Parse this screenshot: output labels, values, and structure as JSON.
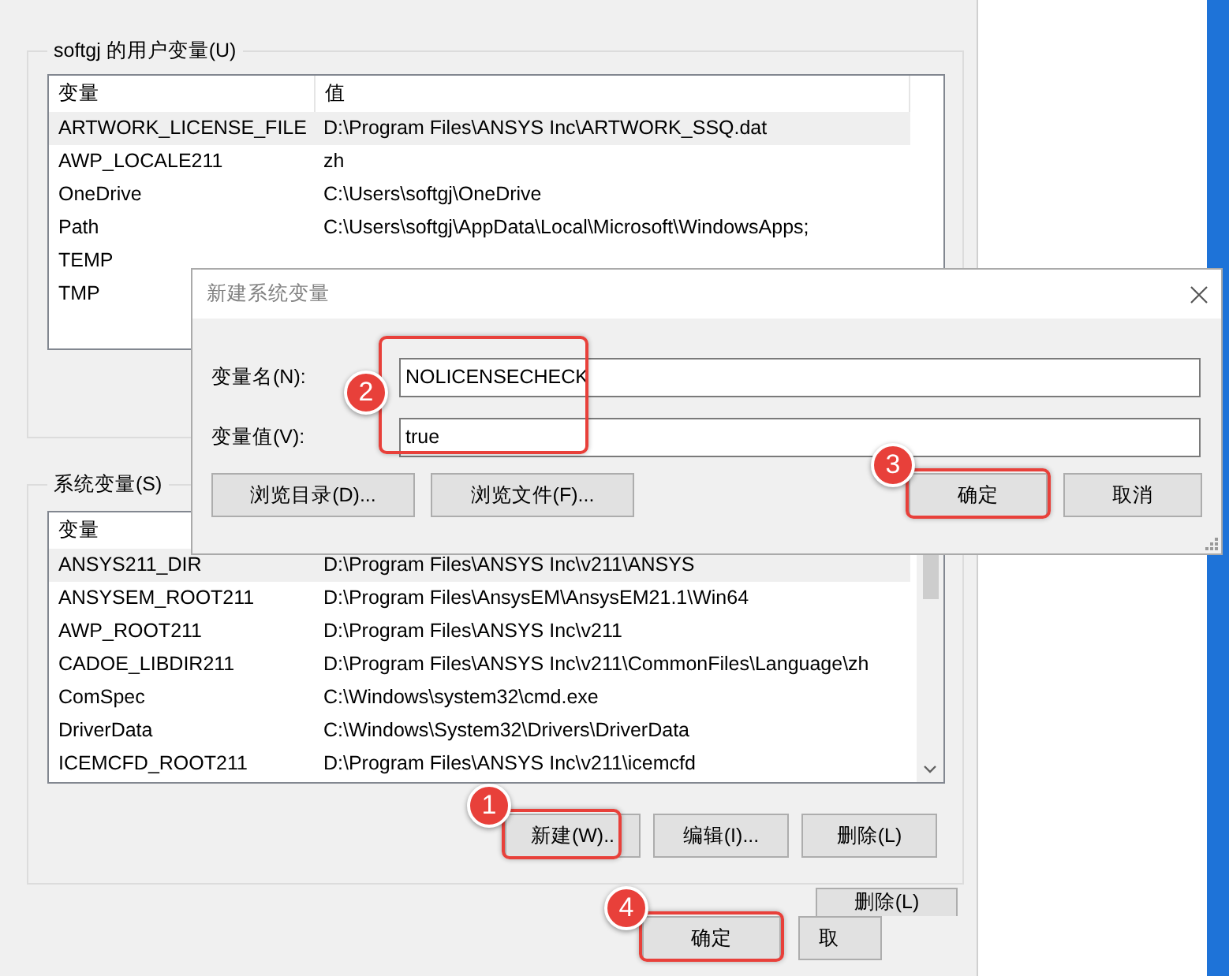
{
  "env_window": {
    "user_variables": {
      "label": "softgj 的用户变量(U)",
      "columns": [
        "变量",
        "值"
      ],
      "rows": [
        {
          "name": "ARTWORK_LICENSE_FILE",
          "value": "D:\\Program Files\\ANSYS Inc\\ARTWORK_SSQ.dat",
          "selected": true
        },
        {
          "name": "AWP_LOCALE211",
          "value": "zh",
          "selected": false
        },
        {
          "name": "OneDrive",
          "value": "C:\\Users\\softgj\\OneDrive",
          "selected": false
        },
        {
          "name": "Path",
          "value": "C:\\Users\\softgj\\AppData\\Local\\Microsoft\\WindowsApps;",
          "selected": false
        },
        {
          "name": "TEMP",
          "selected": false
        },
        {
          "name": "TMP",
          "selected": false
        }
      ]
    },
    "system_variables": {
      "label": "系统变量(S)",
      "columns": [
        "变量"
      ],
      "rows": [
        {
          "name": "ANSYS211_DIR",
          "value": "D:\\Program Files\\ANSYS Inc\\v211\\ANSYS",
          "selected": true
        },
        {
          "name": "ANSYSEM_ROOT211",
          "value": "D:\\Program Files\\AnsysEM\\AnsysEM21.1\\Win64",
          "selected": false
        },
        {
          "name": "AWP_ROOT211",
          "value": "D:\\Program Files\\ANSYS Inc\\v211",
          "selected": false
        },
        {
          "name": "CADOE_LIBDIR211",
          "value": "D:\\Program Files\\ANSYS Inc\\v211\\CommonFiles\\Language\\zh",
          "selected": false
        },
        {
          "name": "ComSpec",
          "value": "C:\\Windows\\system32\\cmd.exe",
          "selected": false
        },
        {
          "name": "DriverData",
          "value": "C:\\Windows\\System32\\Drivers\\DriverData",
          "selected": false
        },
        {
          "name": "ICEMCFD_ROOT211",
          "value": "D:\\Program Files\\ANSYS Inc\\v211\\icemcfd",
          "selected": false
        }
      ],
      "buttons": [
        {
          "label": "新建(W)..",
          "callout": "1"
        },
        {
          "label": "编辑(I)..."
        },
        {
          "label": "删除(L)"
        }
      ]
    },
    "back_button": {
      "label": "删除(L)"
    },
    "buttons": [
      {
        "label": "确定",
        "callout": "4"
      },
      {
        "label": "取"
      }
    ]
  },
  "dialog": {
    "title": "新建系统变量",
    "fields": {
      "callout": "2",
      "items": [
        {
          "label": "变量名(N):",
          "value": "NOLICENSECHECK"
        },
        {
          "label": "变量值(V):",
          "value": "true"
        }
      ]
    },
    "browse_buttons": [
      {
        "label": "浏览目录(D)..."
      },
      {
        "label": "浏览文件(F)..."
      }
    ],
    "buttons": [
      {
        "label": "确定",
        "callout": "3"
      },
      {
        "label": "取消"
      }
    ]
  }
}
